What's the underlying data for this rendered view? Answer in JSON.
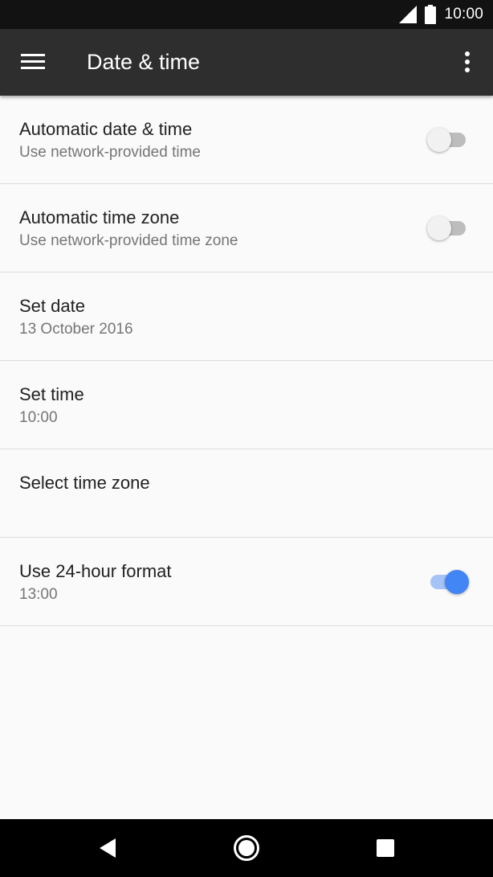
{
  "status_bar": {
    "time": "10:00",
    "icons": [
      "signal-icon",
      "battery-icon"
    ]
  },
  "app_bar": {
    "title": "Date & time",
    "left_icon": "menu-icon",
    "right_icon": "more-vert-icon",
    "background": "#2e2e2e"
  },
  "settings": {
    "items": [
      {
        "title": "Automatic date & time",
        "subtitle": "Use network-provided time",
        "toggle": false
      },
      {
        "title": "Automatic time zone",
        "subtitle": "Use network-provided time zone",
        "toggle": false
      },
      {
        "title": "Set date",
        "subtitle": "13 October 2016"
      },
      {
        "title": "Set time",
        "subtitle": "10:00"
      },
      {
        "title": "Select time zone",
        "subtitle": ""
      },
      {
        "title": "Use 24-hour format",
        "subtitle": "13:00",
        "toggle": true
      }
    ]
  },
  "nav_bar": {
    "icons": [
      "back-icon",
      "home-icon",
      "recents-icon"
    ]
  },
  "colors": {
    "accent": "#4285f4",
    "background": "#fafafa",
    "status_bar": "#121212"
  }
}
